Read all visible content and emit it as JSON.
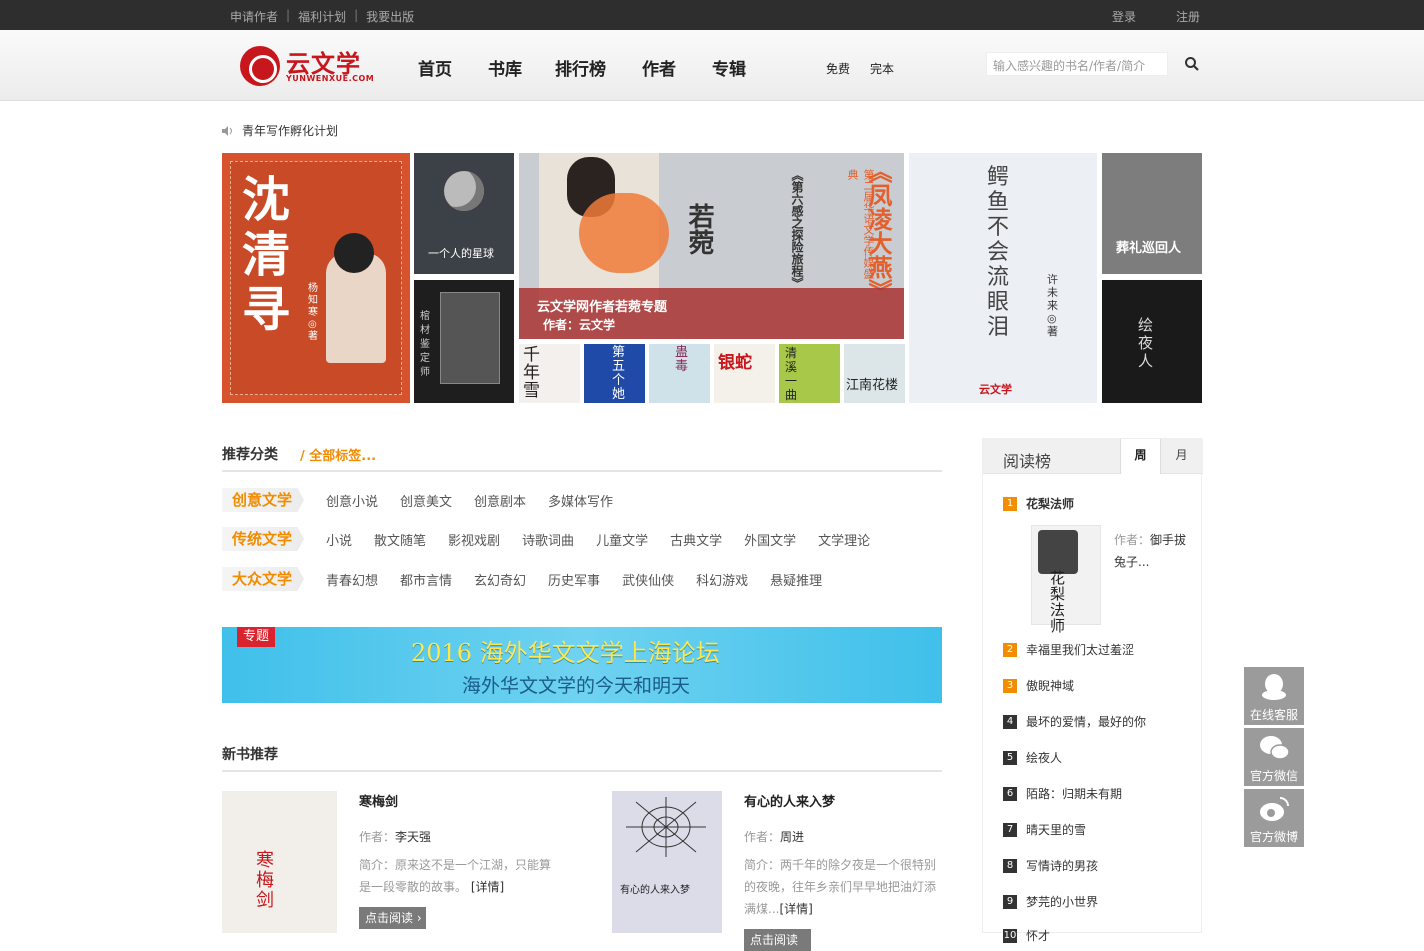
{
  "topbar": {
    "links": [
      "申请作者",
      "福利计划",
      "我要出版"
    ],
    "login": "登录",
    "register": "注册"
  },
  "brand": {
    "name_cn": "云文学",
    "name_en": "YUNWENXUE.COM",
    "color": "#c8161d"
  },
  "nav": [
    "首页",
    "书库",
    "排行榜",
    "作者",
    "专辑"
  ],
  "subnav": [
    "免费",
    "完本"
  ],
  "search": {
    "placeholder": "输入感兴趣的书名/作者/简介"
  },
  "notice": "青年写作孵化计划",
  "banners": {
    "b1_title": "沈清寻",
    "b1_author": "杨知寒◎著",
    "b2_title": "一个人的星球",
    "b3_title": "棺材鉴定师",
    "b4_vert1": "《凤凌大燕》",
    "b4_vert2": "第二届华语文学传媒盛典",
    "b4_vert3": "《第六感之探险旅程》",
    "b4_vert4": "若菀",
    "b4_caption": "云文学网作者若菀专题",
    "b4_author": "作者：云文学",
    "thumbs": [
      "千年雪",
      "第五个她",
      "蛊毒",
      "银蛇",
      "清溪一曲",
      "江南花楼"
    ],
    "b5_title": "鳄鱼不会流眼泪",
    "b5_author": "许未来◎著",
    "b5_logo": "云文学",
    "b6_title": "葬礼巡回人",
    "b7_title": "绘夜人"
  },
  "categories": {
    "header": "推荐分类",
    "all_tags": "/ 全部标签...",
    "rows": [
      {
        "tag": "创意文学",
        "items": [
          "创意小说",
          "创意美文",
          "创意剧本",
          "多媒体写作"
        ]
      },
      {
        "tag": "传统文学",
        "items": [
          "小说",
          "散文随笔",
          "影视戏剧",
          "诗歌词曲",
          "儿童文学",
          "古典文学",
          "外国文学",
          "文学理论"
        ]
      },
      {
        "tag": "大众文学",
        "items": [
          "青春幻想",
          "都市言情",
          "玄幻奇幻",
          "历史军事",
          "武侠仙侠",
          "科幻游戏",
          "悬疑推理"
        ]
      }
    ]
  },
  "promo": {
    "badge": "专题",
    "line1": "2016 海外华文文学上海论坛",
    "line2": "海外华文文学的今天和明天"
  },
  "new_books": {
    "header": "新书推荐",
    "books": [
      {
        "title": "寒梅剑",
        "author_label": "作者：",
        "author": "李天强",
        "desc_label": "简介：",
        "desc": "原来这不是一个江湖，只能算是一段零散的故事。",
        "detail": "[详情]",
        "read": "点击阅读"
      },
      {
        "title": "有心的人来入梦",
        "author_label": "作者：",
        "author": "周进",
        "desc_label": "简介：",
        "desc": "两千年的除夕夜是一个很特别的夜晚，往年乡亲们早早地把油灯添满煤...",
        "detail": "[详情]",
        "read": "点击阅读"
      }
    ]
  },
  "ranking": {
    "title": "阅读榜",
    "tab_week": "周",
    "tab_month": "月",
    "top_author_label": "作者：",
    "top_author": "御手拔兔子...",
    "items": [
      "花梨法师",
      "幸福里我们太过羞涩",
      "傲睨神域",
      "最坏的爱情，最好的你",
      "绘夜人",
      "陌路：归期未有期",
      "晴天里的雪",
      "写情诗的男孩",
      "梦芫的小世界",
      "怀才"
    ]
  },
  "float": {
    "service": "在线客服",
    "wechat": "官方微信",
    "weibo": "官方微博"
  }
}
